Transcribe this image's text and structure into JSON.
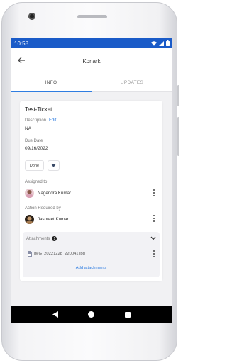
{
  "status_bar": {
    "time": "10:58",
    "icons": [
      "wifi-icon",
      "signal-icon",
      "battery-icon"
    ]
  },
  "app_bar": {
    "title": "Konark",
    "back_icon": "arrow-back-icon"
  },
  "tabs": [
    {
      "label": "INFO",
      "active": true
    },
    {
      "label": "UPDATES",
      "active": false
    }
  ],
  "ticket": {
    "name": "Test-Ticket",
    "description_label": "Description",
    "edit_label": "Edit",
    "description_value": "NA",
    "due_date_label": "Due Date",
    "due_date_value": "09/16/2022",
    "status_button": "Done",
    "assigned_to_label": "Assigned to",
    "assigned_to_name": "Nagendra Kumar",
    "action_required_label": "Action Required by",
    "action_required_name": "Jaspreet Kumar",
    "attachments_label": "Attachments",
    "attachments_count": "1",
    "file_name": "IMG_20221228_220041.jpg",
    "add_attachments_label": "Add attachments"
  },
  "colors": {
    "status_bar": "#1a5bc8",
    "accent": "#2f7de1"
  },
  "nav_buttons": [
    "back-triangle-icon",
    "home-circle-icon",
    "recents-square-icon"
  ]
}
